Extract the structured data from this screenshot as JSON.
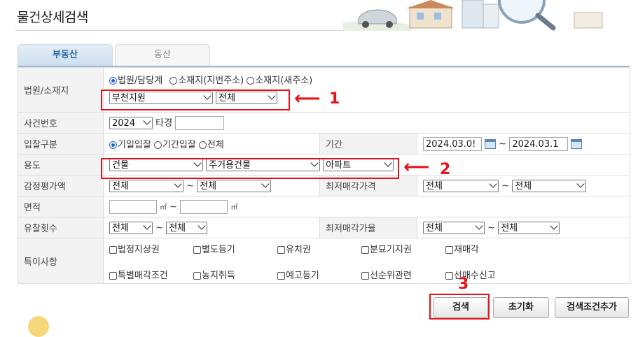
{
  "page": {
    "title": "물건상세검색"
  },
  "tabs": [
    {
      "label": "부동산"
    },
    {
      "label": "동산"
    }
  ],
  "rows": {
    "court": {
      "label": "법원/소재지",
      "radios": [
        "법원/담당계",
        "소재지(지번주소)",
        "소재지(새주소)"
      ],
      "selected_radio": "법원/담당계",
      "court_select": "부천지원",
      "dept_select": "전체"
    },
    "case": {
      "label": "사건번호",
      "year": "2024",
      "suffix": "타경",
      "number": ""
    },
    "bid": {
      "label": "입찰구분",
      "radios": [
        "기일입찰",
        "기간입찰",
        "전체"
      ],
      "selected_radio": "기일입찰",
      "period_label": "기간",
      "date_from": "2024.03.0!",
      "tilde": "~",
      "date_to": "2024.03.1"
    },
    "usage": {
      "label": "용도",
      "select1": "건물",
      "select2": "주거용건물",
      "select3": "아파트"
    },
    "appraisal": {
      "label": "감정평가액",
      "from": "전체",
      "tilde": "~",
      "to": "전체",
      "min_price_label": "최저매각가격",
      "min_from": "전체",
      "min_to": "전체"
    },
    "area": {
      "label": "면적",
      "unit": "㎡",
      "tilde": "~"
    },
    "failed": {
      "label": "유찰횟수",
      "from": "전체",
      "tilde": "~",
      "to": "전체",
      "rate_label": "최저매각가율",
      "rate_from": "전체",
      "rate_to": "전체"
    },
    "special": {
      "label": "특이사항",
      "options": [
        "법정지상권",
        "별도등기",
        "유치권",
        "분묘기지권",
        "재매각",
        "특별매각조건",
        "농지취득",
        "예고등기",
        "선순위관련",
        "선매수신고"
      ]
    }
  },
  "buttons": {
    "search": "검색",
    "reset": "초기화",
    "add_condition": "검색조건추가"
  },
  "annotations": {
    "one": "1",
    "two": "2",
    "three": "3",
    "arrow": "⟵"
  },
  "colors": {
    "highlight": "#e3141b",
    "tab_active": "#2d6aa3"
  }
}
